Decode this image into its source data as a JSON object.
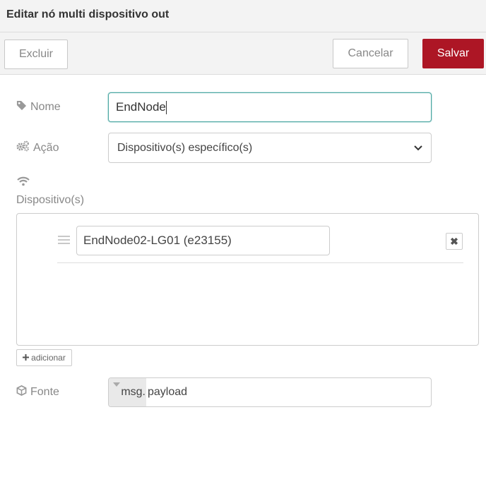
{
  "dialog": {
    "title": "Editar nó multi dispositivo out"
  },
  "toolbar": {
    "delete_label": "Excluir",
    "cancel_label": "Cancelar",
    "save_label": "Salvar",
    "save_color": "#ad1625"
  },
  "form": {
    "name": {
      "label": "Nome",
      "value": "EndNode",
      "icon": "tag-icon"
    },
    "action": {
      "label": "Ação",
      "selected": "Dispositivo(s) específico(s)",
      "icon": "cogs-icon"
    },
    "devices": {
      "label": "Dispositivo(s)",
      "icon": "wifi-icon",
      "items": [
        {
          "value": "EndNode02-LG01 (e23155)"
        }
      ],
      "remove_label": "✖",
      "add_label": "adicionar"
    },
    "source": {
      "label": "Fonte",
      "type_prefix": "msg.",
      "value": "payload",
      "icon": "cube-icon"
    }
  }
}
